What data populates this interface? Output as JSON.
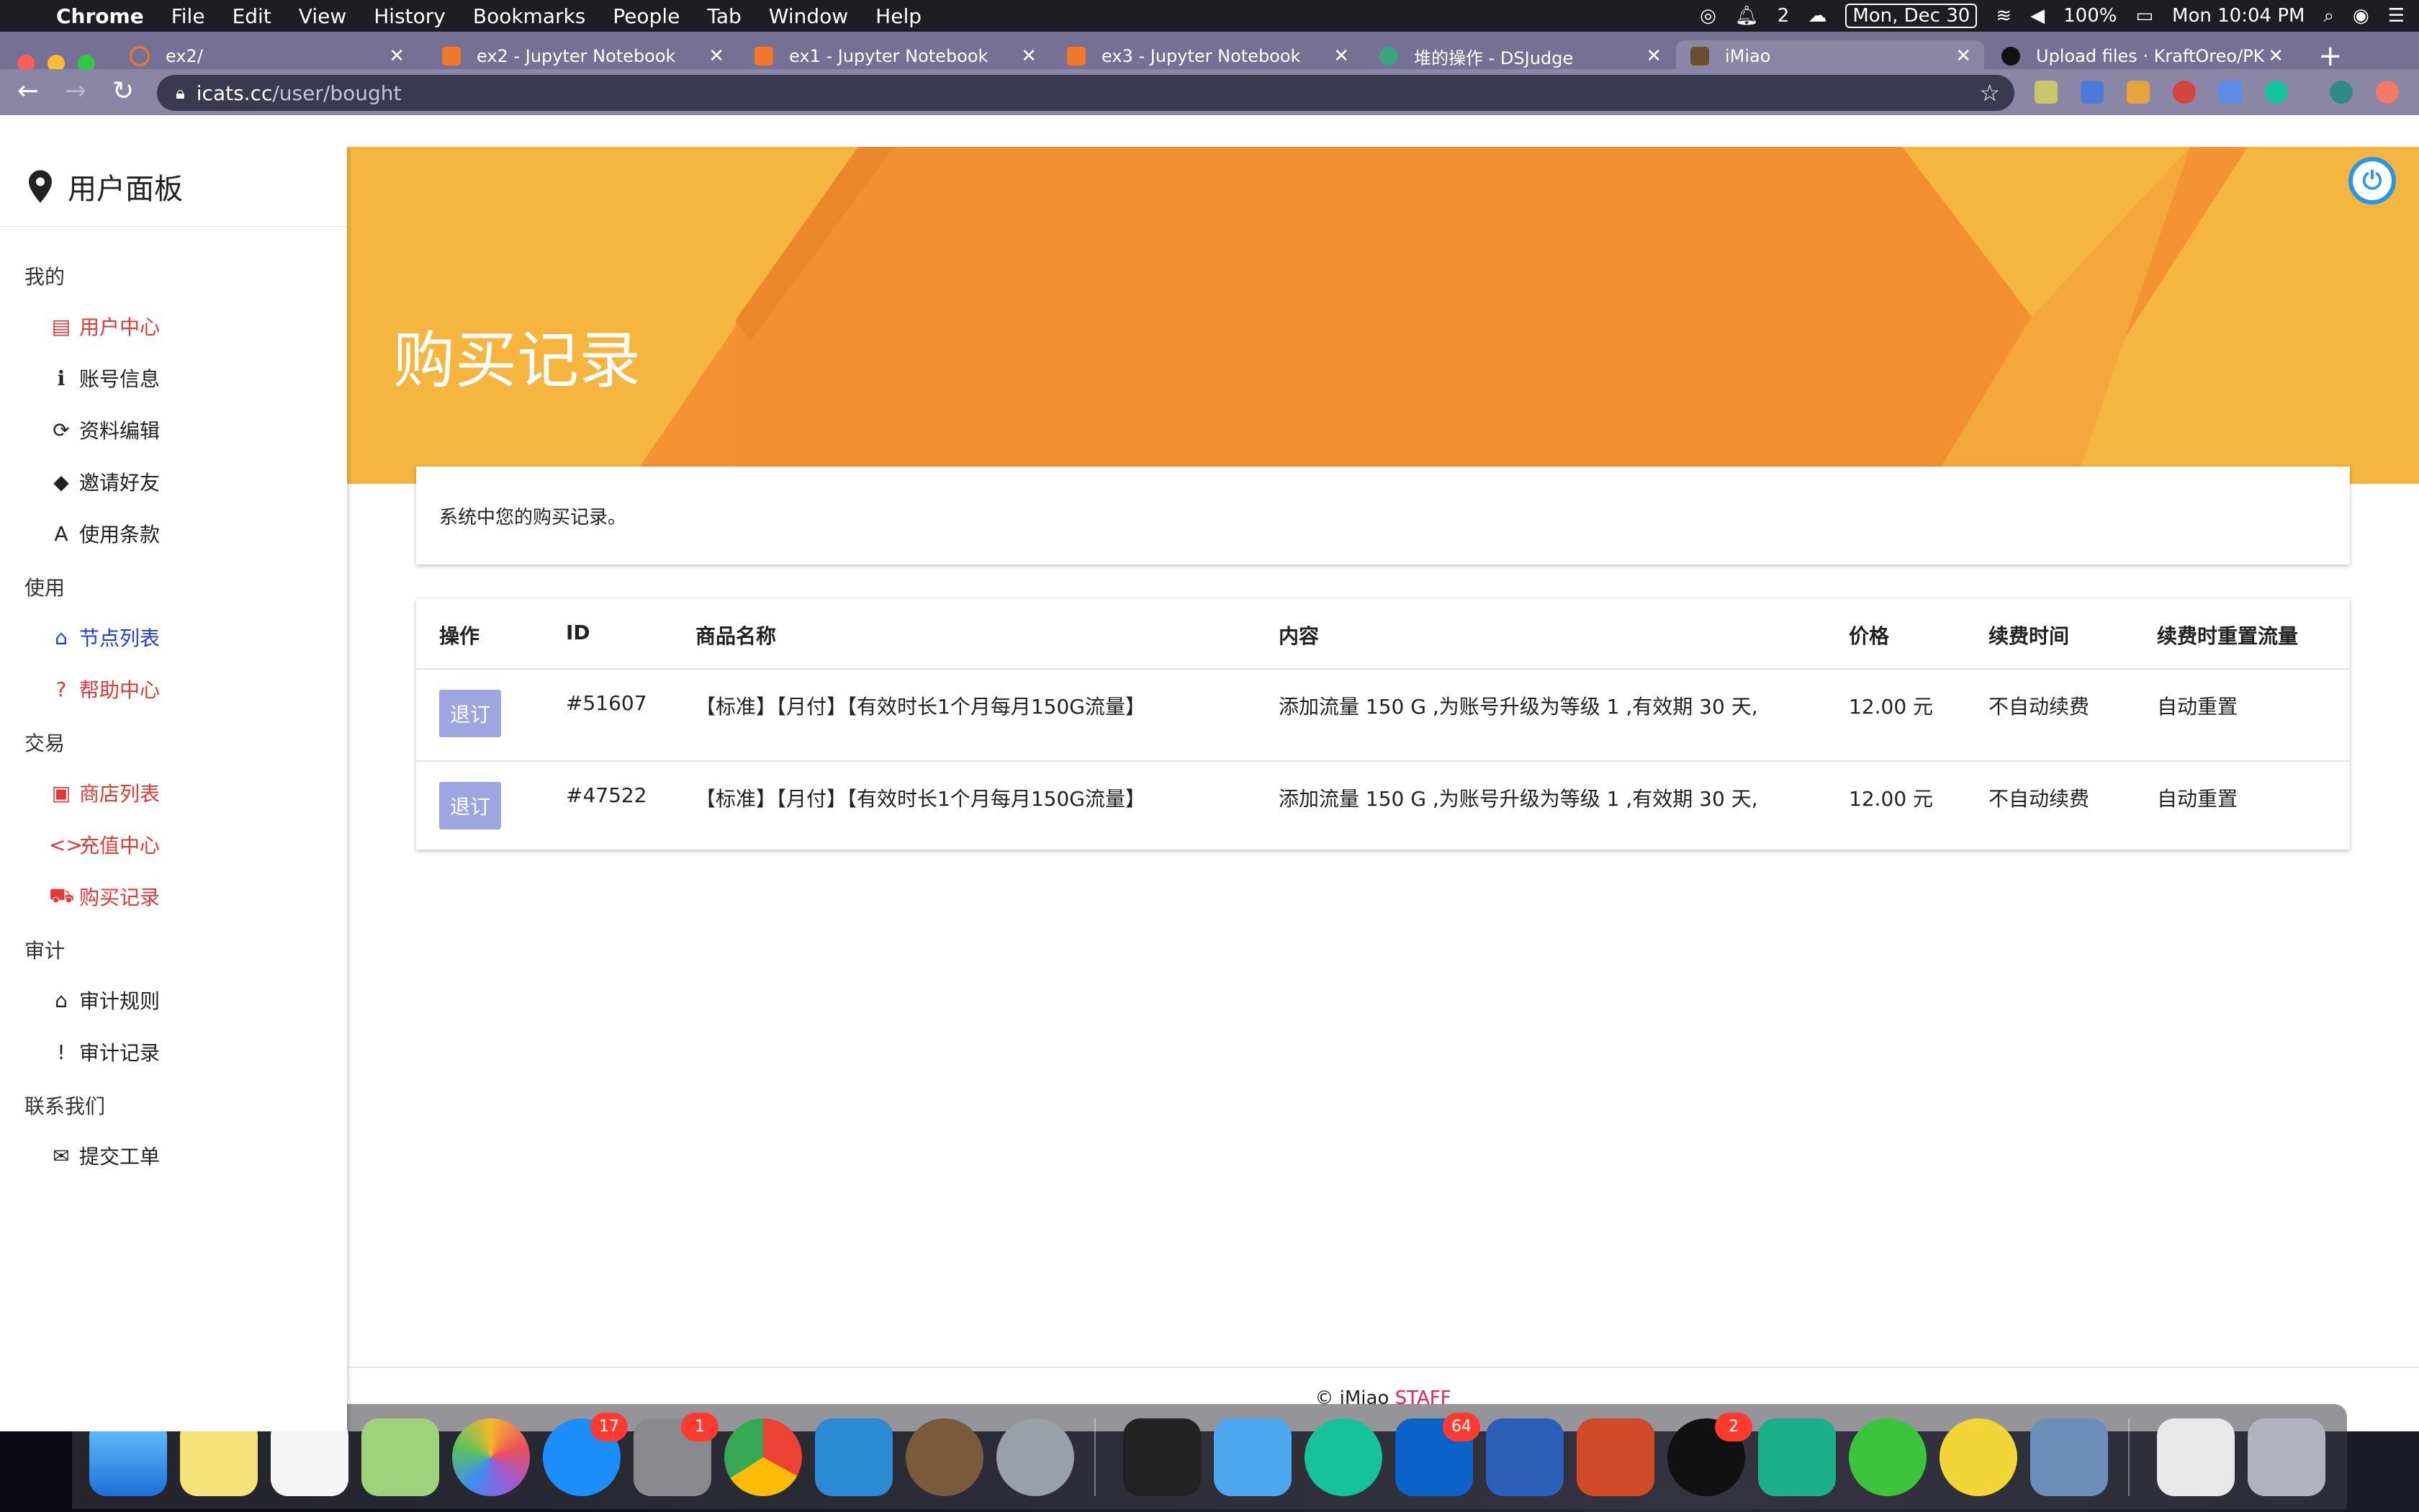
{
  "menubar": {
    "app": "Chrome",
    "items": [
      "File",
      "Edit",
      "View",
      "History",
      "Bookmarks",
      "People",
      "Tab",
      "Window",
      "Help"
    ],
    "notification_count": "2",
    "date": "Mon, Dec 30",
    "battery": "100%",
    "time": "Mon 10:04 PM"
  },
  "browser": {
    "tabs": [
      {
        "title": "ex2/",
        "icon_color": "#f37726"
      },
      {
        "title": "ex2 - Jupyter Notebook",
        "icon_color": "#f37726"
      },
      {
        "title": "ex1 - Jupyter Notebook",
        "icon_color": "#f37726"
      },
      {
        "title": "ex3 - Jupyter Notebook",
        "icon_color": "#f37726"
      },
      {
        "title": "堆的操作 - DSJudge",
        "icon_color": "#3aa57a"
      },
      {
        "title": "iMiao",
        "icon_color": "#6b4e2e"
      },
      {
        "title": "Upload files · KraftOreo/PK",
        "icon_color": "#111111"
      }
    ],
    "url_host": "icats.cc",
    "url_path": "/user/bought"
  },
  "sidebar": {
    "title": "用户面板",
    "sections": [
      {
        "label": "我的",
        "items": [
          {
            "label": "用户中心",
            "icon": "id-card-icon",
            "glyph": "▤",
            "color": "red"
          },
          {
            "label": "账号信息",
            "icon": "info-icon",
            "glyph": "ℹ",
            "color": "dark"
          },
          {
            "label": "资料编辑",
            "icon": "sync-icon",
            "glyph": "⟳",
            "color": "dark"
          },
          {
            "label": "邀请好友",
            "icon": "tag-icon",
            "glyph": "◆",
            "color": "dark"
          },
          {
            "label": "使用条款",
            "icon": "text-icon",
            "glyph": "A",
            "color": "dark"
          }
        ]
      },
      {
        "label": "使用",
        "items": [
          {
            "label": "节点列表",
            "icon": "router-icon",
            "glyph": "⌂",
            "color": "blue"
          },
          {
            "label": "帮助中心",
            "icon": "help-icon",
            "glyph": "?",
            "color": "red"
          }
        ]
      },
      {
        "label": "交易",
        "items": [
          {
            "label": "商店列表",
            "icon": "shop-icon",
            "glyph": "▣",
            "color": "red"
          },
          {
            "label": "充值中心",
            "icon": "code-icon",
            "glyph": "<>",
            "color": "red"
          },
          {
            "label": "购买记录",
            "icon": "cart-icon",
            "glyph": "⛟",
            "color": "red"
          }
        ]
      },
      {
        "label": "审计",
        "items": [
          {
            "label": "审计规则",
            "icon": "bank-icon",
            "glyph": "⌂",
            "color": "dark"
          },
          {
            "label": "审计记录",
            "icon": "alert-icon",
            "glyph": "!",
            "color": "dark"
          }
        ]
      },
      {
        "label": "联系我们",
        "items": [
          {
            "label": "提交工单",
            "icon": "chat-icon",
            "glyph": "✉",
            "color": "dark"
          }
        ]
      }
    ]
  },
  "main": {
    "page_title": "购买记录",
    "description": "系统中您的购买记录。",
    "table": {
      "headers": [
        "操作",
        "ID",
        "商品名称",
        "内容",
        "价格",
        "续费时间",
        "续费时重置流量"
      ],
      "rows": [
        {
          "action": "退订",
          "id": "#51607",
          "name": "【标准】【月付】【有效时长1个月每月150G流量】",
          "content": "添加流量 150 G ,为账号升级为等级 1 ,有效期 30 天,",
          "price": "12.00 元",
          "renew": "不自动续费",
          "reset": "自动重置"
        },
        {
          "action": "退订",
          "id": "#47522",
          "name": "【标准】【月付】【有效时长1个月每月150G流量】",
          "content": "添加流量 150 G ,为账号升级为等级 1 ,有效期 30 天,",
          "price": "12.00 元",
          "renew": "不自动续费",
          "reset": "自动重置"
        }
      ]
    },
    "footer": {
      "copyright": "© iMiao ",
      "staff": "STAFF"
    }
  },
  "dock": {
    "badges": {
      "app_store": "17",
      "system_prefs": "1",
      "outlook": "64",
      "qq": "2"
    }
  },
  "colors": {
    "hero_orange": "#f39333",
    "hero_light": "#f5b53f",
    "accent_red": "#e53935",
    "accent_blue": "#1e3fd6",
    "refund_button": "#9ea6e0",
    "tab_strip": "#777095"
  }
}
